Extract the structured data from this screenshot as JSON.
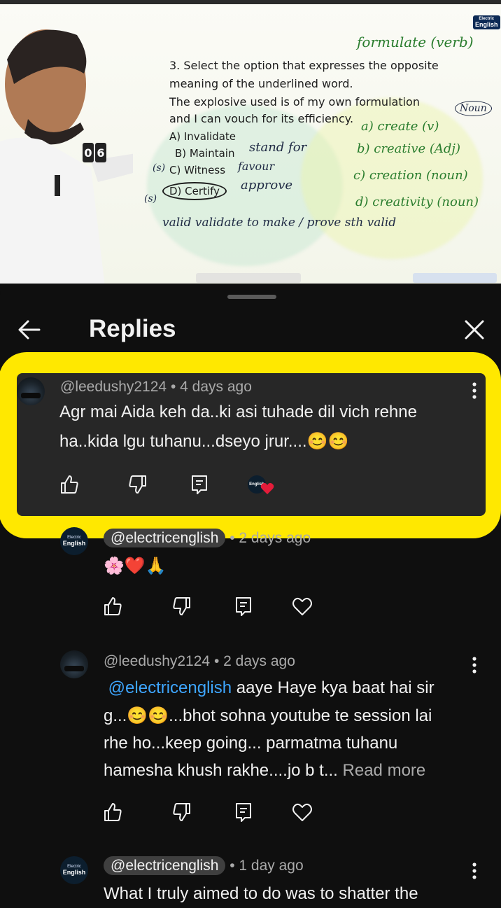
{
  "video": {
    "question_lines": [
      "3. Select the option that expresses the opposite",
      "meaning of the underlined word.",
      "The explosive used is of my own formulation",
      "and I can vouch for its efficiency."
    ],
    "options": [
      "A) Invalidate",
      "B) Maintain",
      "C) Witness",
      "D) Certify"
    ],
    "handwriting": {
      "formulate": "formulate (verb)",
      "noun": "Noun",
      "a": "a) create (v)",
      "b": "b) creative (Adj)",
      "c": "c) creation (noun)",
      "d": "d) creativity (noun)",
      "stand_for": "stand for",
      "favour": "favour",
      "approve": "approve",
      "valid_line": "valid  validate  to make / prove sth valid",
      "s1": "(s)",
      "s2": "(s)"
    },
    "counter": [
      "0",
      "6"
    ],
    "logo_small": "Electric",
    "logo_big": "English"
  },
  "header": {
    "title": "Replies"
  },
  "comments": [
    {
      "handle": "@leedushy2124",
      "meta": " • 4 days ago",
      "line1": "Agr mai Aida keh da..ki asi tuhade dil vich rehne",
      "line2": "ha..kida lgu tuhanu...dseyo jrur....",
      "emoji": "😊😊",
      "heart_badge": "English"
    },
    {
      "handle": "@electricenglish",
      "meta": " • 2 days ago",
      "line1": "🌸❤️🙏",
      "avatar_small": "Electric",
      "avatar_big": "English"
    },
    {
      "handle": "@leedushy2124",
      "meta": " • 2 days ago",
      "mention": "@electricenglish",
      "line1_rest": " aaye Haye kya baat hai sir",
      "line2_a": "g...",
      "line2_emoji": "😊😊",
      "line2_b": "...bhot sohna youtube te session lai",
      "line3": "rhe ho...keep going... parmatma tuhanu",
      "line4": "hamesha khush rakhe....jo b t... ",
      "read_more": "Read more"
    },
    {
      "handle": "@electricenglish",
      "meta": " • 1 day ago",
      "line1": "What I truly aimed to do was to shatter the",
      "avatar_small": "Electric",
      "avatar_big": "English"
    }
  ],
  "colors": {
    "highlight": "#ffe800",
    "card": "#272727",
    "bg": "#0f0f0f",
    "link": "#3ea6ff"
  }
}
